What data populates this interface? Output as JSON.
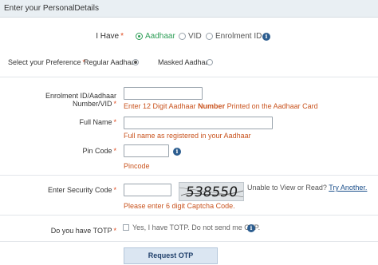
{
  "header": {
    "title": "Enter your PersonalDetails"
  },
  "have": {
    "label": "I Have",
    "options": [
      "Aadhaar",
      "VID",
      "Enrolment ID"
    ],
    "selected": "Aadhaar"
  },
  "preference": {
    "label": "Select your Preference",
    "options": [
      "Regular Aadhaar",
      "Masked Aadhaar"
    ],
    "selected": "Regular Aadhaar"
  },
  "required_mark": "*",
  "fields": {
    "enrolment": {
      "label": "Enrolment ID/Aadhaar Number/VID",
      "value": "",
      "hint_pre": "Enter 12 Digit Aadhaar ",
      "hint_bold": "Number",
      "hint_post": " Printed on the Aadhaar Card"
    },
    "full_name": {
      "label": "Full Name",
      "value": "",
      "hint": "Full name as registered in your Aadhaar"
    },
    "pin_code": {
      "label": "Pin Code",
      "value": "",
      "hint": "Pincode"
    },
    "security_code": {
      "label": "Enter Security Code",
      "value": "",
      "captcha_text": "538550",
      "unable_text": "Unable to View or Read? ",
      "try_another": "Try Another.",
      "hint": "Please enter 6 digit Captcha Code."
    },
    "totp": {
      "label": "Do you have TOTP",
      "checkbox_text": "Yes, I have TOTP. Do not send me OTP.",
      "checked": false
    }
  },
  "icons": {
    "info": "i"
  },
  "buttons": {
    "request_otp": "Request OTP"
  },
  "colors": {
    "accent_green": "#2e9e57",
    "hint_orange": "#c9541f",
    "info_blue": "#2c5d8f",
    "link_blue": "#1a4e8a"
  }
}
